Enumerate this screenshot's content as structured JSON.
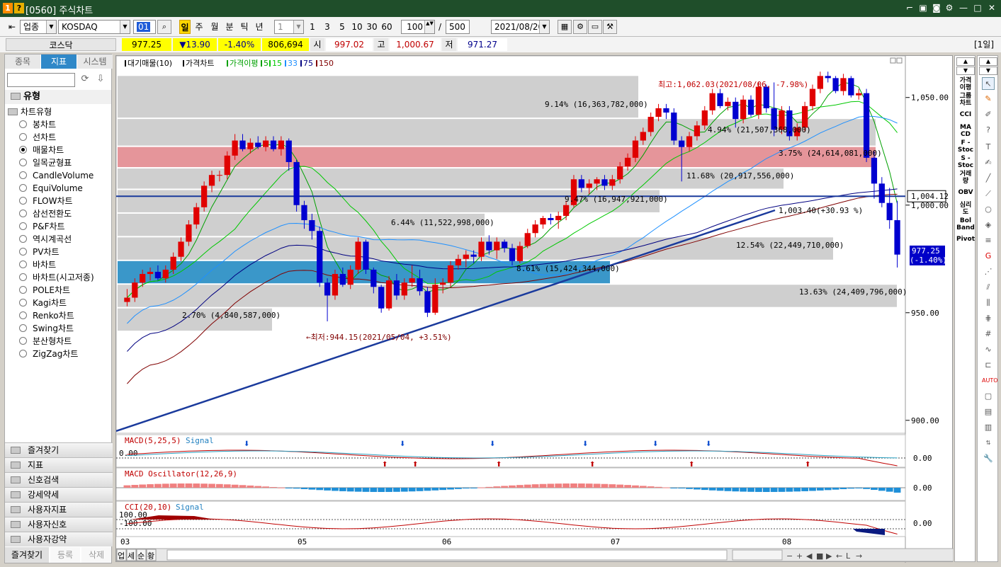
{
  "window": {
    "number_badge": "1",
    "question_badge": "?",
    "title": "[0560] 주식차트"
  },
  "toolbar": {
    "category": "업종",
    "market": "KOSDAQ",
    "code": "01",
    "periods": [
      "일",
      "주",
      "월",
      "분",
      "틱",
      "년"
    ],
    "tick_value": "1",
    "quick_counts": [
      "1",
      "3",
      "5",
      "10",
      "30",
      "60"
    ],
    "display_count": "100",
    "slash": "/",
    "total_count": "500",
    "date": "2021/08/20"
  },
  "quote": {
    "name": "코스닥",
    "price": "977.25",
    "change": "▼13.90",
    "change_pct": "-1.40%",
    "volume": "806,694",
    "open_label": "시",
    "open": "997.02",
    "high_label": "고",
    "high": "1,000.67",
    "low_label": "저",
    "low": "971.27",
    "period_badge": "[1일]"
  },
  "left_panel": {
    "tabs": [
      "종목",
      "지표",
      "시스템"
    ],
    "active_tab": 1,
    "section_title": "유형",
    "group_title": "차트유형",
    "chart_types": [
      "봉차트",
      "선차트",
      "매물차트",
      "일목균형표",
      "CandleVolume",
      "EquiVolume",
      "FLOW차트",
      "삼선전환도",
      "P&F차트",
      "역시계곡선",
      "PV차트",
      "바차트",
      "바차트(시고저종)",
      "POLE차트",
      "Kagi차트",
      "Renko차트",
      "Swing차트",
      "분산형차트",
      "ZigZag차트"
    ],
    "selected_index": 2,
    "folders": [
      "즐겨찾기",
      "지표",
      "신호검색",
      "강세약세",
      "사용자지표",
      "사용자신호",
      "사용자강약"
    ],
    "bottom_tabs": [
      "즐겨찾기",
      "등록",
      "삭제"
    ]
  },
  "chart": {
    "legend": [
      {
        "text": "대기매물(10)",
        "color": "#000000"
      },
      {
        "text": "가격차트",
        "color": "#000000"
      },
      {
        "text": "가격이평",
        "color": "#00a000"
      },
      {
        "text": "5",
        "color": "#00a000"
      },
      {
        "text": "15",
        "color": "#00c800"
      },
      {
        "text": "33",
        "color": "#1e90ff"
      },
      {
        "text": "75",
        "color": "#000080"
      },
      {
        "text": "150",
        "color": "#800000"
      }
    ],
    "y_ticks": [
      "1,050.00",
      "1,000.00",
      "950.00",
      "900.00"
    ],
    "x_ticks": [
      "03",
      "05",
      "06",
      "07",
      "08"
    ],
    "high_note": "최고:1,062.03(2021/08/06, -7.98%)",
    "low_note": "←최저:944.15(2021/05/04, +3.51%)",
    "trend_label": "1,003.40(+30.93 %)",
    "hline_label": "1,004.12",
    "price_tag": "977.25",
    "price_tag_pct": "(-1.40%)",
    "volume_profile_labels": [
      "9.14% (16,363,782,000)",
      "4.94% (21,507,368,000)",
      "3.75% (24,614,081,000)",
      "11.68% (20,917,556,000)",
      "9.47% (16,947,921,000)",
      "6.44% (11,522,998,000)",
      "12.54% (22,449,710,000)",
      "8.61% (15,424,344,000)",
      "13.63% (24,409,796,000)",
      "2.70% (4,840,587,000)"
    ],
    "sub_macd": {
      "title": "MACD(5,25,5)",
      "signal": "Signal",
      "left_value": "0.00",
      "right_value": "0.00"
    },
    "sub_osc": {
      "title": "MACD Oscillator(12,26,9)",
      "right_value": "0.00"
    },
    "sub_cci": {
      "title": "CCI(20,10)",
      "signal": "Signal",
      "upper": "100.00",
      "lower": "-100.00",
      "right_value": "0.00"
    },
    "bottom_tabs": [
      "업",
      "세",
      "순",
      "황"
    ]
  },
  "chart_data": {
    "type": "candlestick",
    "title": "",
    "ylabel": "",
    "ylim": [
      895,
      1068
    ],
    "x_month_labels": [
      "03",
      "05",
      "06",
      "07",
      "08"
    ],
    "candles": [
      {
        "o": 955,
        "h": 961,
        "l": 953,
        "c": 957
      },
      {
        "o": 957,
        "h": 966,
        "l": 955,
        "c": 964
      },
      {
        "o": 964,
        "h": 970,
        "l": 962,
        "c": 968
      },
      {
        "o": 968,
        "h": 971,
        "l": 965,
        "c": 969
      },
      {
        "o": 969,
        "h": 972,
        "l": 965,
        "c": 966
      },
      {
        "o": 966,
        "h": 972,
        "l": 964,
        "c": 970
      },
      {
        "o": 970,
        "h": 978,
        "l": 968,
        "c": 976
      },
      {
        "o": 976,
        "h": 985,
        "l": 974,
        "c": 983
      },
      {
        "o": 983,
        "h": 993,
        "l": 981,
        "c": 991
      },
      {
        "o": 991,
        "h": 1001,
        "l": 989,
        "c": 999
      },
      {
        "o": 999,
        "h": 1011,
        "l": 997,
        "c": 1009
      },
      {
        "o": 1009,
        "h": 1016,
        "l": 1006,
        "c": 1014
      },
      {
        "o": 1014,
        "h": 1016,
        "l": 1011,
        "c": 1014
      },
      {
        "o": 1014,
        "h": 1025,
        "l": 1012,
        "c": 1023
      },
      {
        "o": 1023,
        "h": 1033,
        "l": 1021,
        "c": 1030
      },
      {
        "o": 1030,
        "h": 1033,
        "l": 1025,
        "c": 1026
      },
      {
        "o": 1026,
        "h": 1031,
        "l": 1024,
        "c": 1029
      },
      {
        "o": 1029,
        "h": 1032,
        "l": 1026,
        "c": 1027
      },
      {
        "o": 1027,
        "h": 1032,
        "l": 1025,
        "c": 1030
      },
      {
        "o": 1030,
        "h": 1032,
        "l": 1025,
        "c": 1026
      },
      {
        "o": 1026,
        "h": 1032,
        "l": 1023,
        "c": 1030
      },
      {
        "o": 1030,
        "h": 1031,
        "l": 1016,
        "c": 1020
      },
      {
        "o": 1020,
        "h": 1021,
        "l": 997,
        "c": 1000
      },
      {
        "o": 1000,
        "h": 1002,
        "l": 989,
        "c": 993
      },
      {
        "o": 993,
        "h": 996,
        "l": 984,
        "c": 988
      },
      {
        "o": 988,
        "h": 990,
        "l": 962,
        "c": 964
      },
      {
        "o": 964,
        "h": 966,
        "l": 946,
        "c": 958
      },
      {
        "o": 958,
        "h": 970,
        "l": 956,
        "c": 968
      },
      {
        "o": 968,
        "h": 971,
        "l": 962,
        "c": 963
      },
      {
        "o": 963,
        "h": 972,
        "l": 961,
        "c": 970
      },
      {
        "o": 970,
        "h": 985,
        "l": 968,
        "c": 983
      },
      {
        "o": 983,
        "h": 984,
        "l": 968,
        "c": 970
      },
      {
        "o": 970,
        "h": 971,
        "l": 959,
        "c": 962
      },
      {
        "o": 962,
        "h": 963,
        "l": 950,
        "c": 952
      },
      {
        "o": 952,
        "h": 967,
        "l": 951,
        "c": 965
      },
      {
        "o": 965,
        "h": 968,
        "l": 956,
        "c": 958
      },
      {
        "o": 958,
        "h": 966,
        "l": 956,
        "c": 964
      },
      {
        "o": 964,
        "h": 972,
        "l": 962,
        "c": 966
      },
      {
        "o": 966,
        "h": 970,
        "l": 958,
        "c": 960
      },
      {
        "o": 960,
        "h": 962,
        "l": 948,
        "c": 950
      },
      {
        "o": 950,
        "h": 966,
        "l": 949,
        "c": 963
      },
      {
        "o": 963,
        "h": 966,
        "l": 959,
        "c": 964
      },
      {
        "o": 964,
        "h": 974,
        "l": 962,
        "c": 972
      },
      {
        "o": 972,
        "h": 977,
        "l": 970,
        "c": 975
      },
      {
        "o": 975,
        "h": 979,
        "l": 971,
        "c": 977
      },
      {
        "o": 977,
        "h": 979,
        "l": 973,
        "c": 976
      },
      {
        "o": 976,
        "h": 985,
        "l": 974,
        "c": 983
      },
      {
        "o": 983,
        "h": 986,
        "l": 977,
        "c": 979
      },
      {
        "o": 979,
        "h": 985,
        "l": 975,
        "c": 983
      },
      {
        "o": 983,
        "h": 984,
        "l": 978,
        "c": 980
      },
      {
        "o": 980,
        "h": 982,
        "l": 972,
        "c": 974
      },
      {
        "o": 974,
        "h": 983,
        "l": 973,
        "c": 981
      },
      {
        "o": 981,
        "h": 989,
        "l": 980,
        "c": 987
      },
      {
        "o": 987,
        "h": 993,
        "l": 985,
        "c": 991
      },
      {
        "o": 991,
        "h": 995,
        "l": 989,
        "c": 994
      },
      {
        "o": 994,
        "h": 996,
        "l": 991,
        "c": 993
      },
      {
        "o": 993,
        "h": 997,
        "l": 989,
        "c": 995
      },
      {
        "o": 995,
        "h": 1002,
        "l": 993,
        "c": 1000
      },
      {
        "o": 1000,
        "h": 1014,
        "l": 999,
        "c": 1012
      },
      {
        "o": 1012,
        "h": 1014,
        "l": 1006,
        "c": 1008
      },
      {
        "o": 1008,
        "h": 1012,
        "l": 1005,
        "c": 1010
      },
      {
        "o": 1010,
        "h": 1013,
        "l": 1007,
        "c": 1012
      },
      {
        "o": 1012,
        "h": 1014,
        "l": 1007,
        "c": 1009
      },
      {
        "o": 1009,
        "h": 1014,
        "l": 1007,
        "c": 1012
      },
      {
        "o": 1012,
        "h": 1020,
        "l": 1010,
        "c": 1018
      },
      {
        "o": 1018,
        "h": 1024,
        "l": 1016,
        "c": 1022
      },
      {
        "o": 1022,
        "h": 1032,
        "l": 1020,
        "c": 1030
      },
      {
        "o": 1030,
        "h": 1036,
        "l": 1028,
        "c": 1034
      },
      {
        "o": 1034,
        "h": 1043,
        "l": 1032,
        "c": 1041
      },
      {
        "o": 1041,
        "h": 1047,
        "l": 1039,
        "c": 1045
      },
      {
        "o": 1045,
        "h": 1047,
        "l": 1040,
        "c": 1043
      },
      {
        "o": 1043,
        "h": 1045,
        "l": 1028,
        "c": 1030
      },
      {
        "o": 1030,
        "h": 1032,
        "l": 1011,
        "c": 1027
      },
      {
        "o": 1027,
        "h": 1034,
        "l": 1025,
        "c": 1032
      },
      {
        "o": 1032,
        "h": 1039,
        "l": 1030,
        "c": 1037
      },
      {
        "o": 1037,
        "h": 1046,
        "l": 1035,
        "c": 1044
      },
      {
        "o": 1044,
        "h": 1054,
        "l": 1042,
        "c": 1052
      },
      {
        "o": 1052,
        "h": 1054,
        "l": 1045,
        "c": 1046
      },
      {
        "o": 1046,
        "h": 1050,
        "l": 1044,
        "c": 1048
      },
      {
        "o": 1048,
        "h": 1050,
        "l": 1036,
        "c": 1040
      },
      {
        "o": 1040,
        "h": 1051,
        "l": 1038,
        "c": 1049
      },
      {
        "o": 1049,
        "h": 1051,
        "l": 1041,
        "c": 1042
      },
      {
        "o": 1042,
        "h": 1057,
        "l": 1040,
        "c": 1055
      },
      {
        "o": 1055,
        "h": 1056,
        "l": 1043,
        "c": 1045
      },
      {
        "o": 1045,
        "h": 1057,
        "l": 1032,
        "c": 1035
      },
      {
        "o": 1035,
        "h": 1046,
        "l": 1033,
        "c": 1044
      },
      {
        "o": 1044,
        "h": 1046,
        "l": 1030,
        "c": 1032
      },
      {
        "o": 1032,
        "h": 1038,
        "l": 1030,
        "c": 1036
      },
      {
        "o": 1036,
        "h": 1048,
        "l": 1034,
        "c": 1046
      },
      {
        "o": 1046,
        "h": 1056,
        "l": 1044,
        "c": 1054
      },
      {
        "o": 1054,
        "h": 1062,
        "l": 1052,
        "c": 1060
      },
      {
        "o": 1060,
        "h": 1062,
        "l": 1057,
        "c": 1059
      },
      {
        "o": 1059,
        "h": 1060,
        "l": 1052,
        "c": 1053
      },
      {
        "o": 1053,
        "h": 1061,
        "l": 1051,
        "c": 1059
      },
      {
        "o": 1059,
        "h": 1060,
        "l": 1050,
        "c": 1051
      },
      {
        "o": 1051,
        "h": 1054,
        "l": 1049,
        "c": 1052
      },
      {
        "o": 1052,
        "h": 1054,
        "l": 1020,
        "c": 1022
      },
      {
        "o": 1022,
        "h": 1025,
        "l": 1003,
        "c": 1010
      },
      {
        "o": 1010,
        "h": 1013,
        "l": 999,
        "c": 1001
      },
      {
        "o": 1001,
        "h": 1008,
        "l": 989,
        "c": 993
      },
      {
        "o": 993,
        "h": 1002,
        "l": 971,
        "c": 977
      }
    ],
    "moving_averages": [
      {
        "name": "5",
        "color": "#00a000"
      },
      {
        "name": "15",
        "color": "#00c800"
      },
      {
        "name": "33",
        "color": "#1e90ff"
      },
      {
        "name": "75",
        "color": "#000080"
      },
      {
        "name": "150",
        "color": "#800000"
      }
    ],
    "horizontal_line": 1004.12,
    "last_price": 977.25
  }
}
